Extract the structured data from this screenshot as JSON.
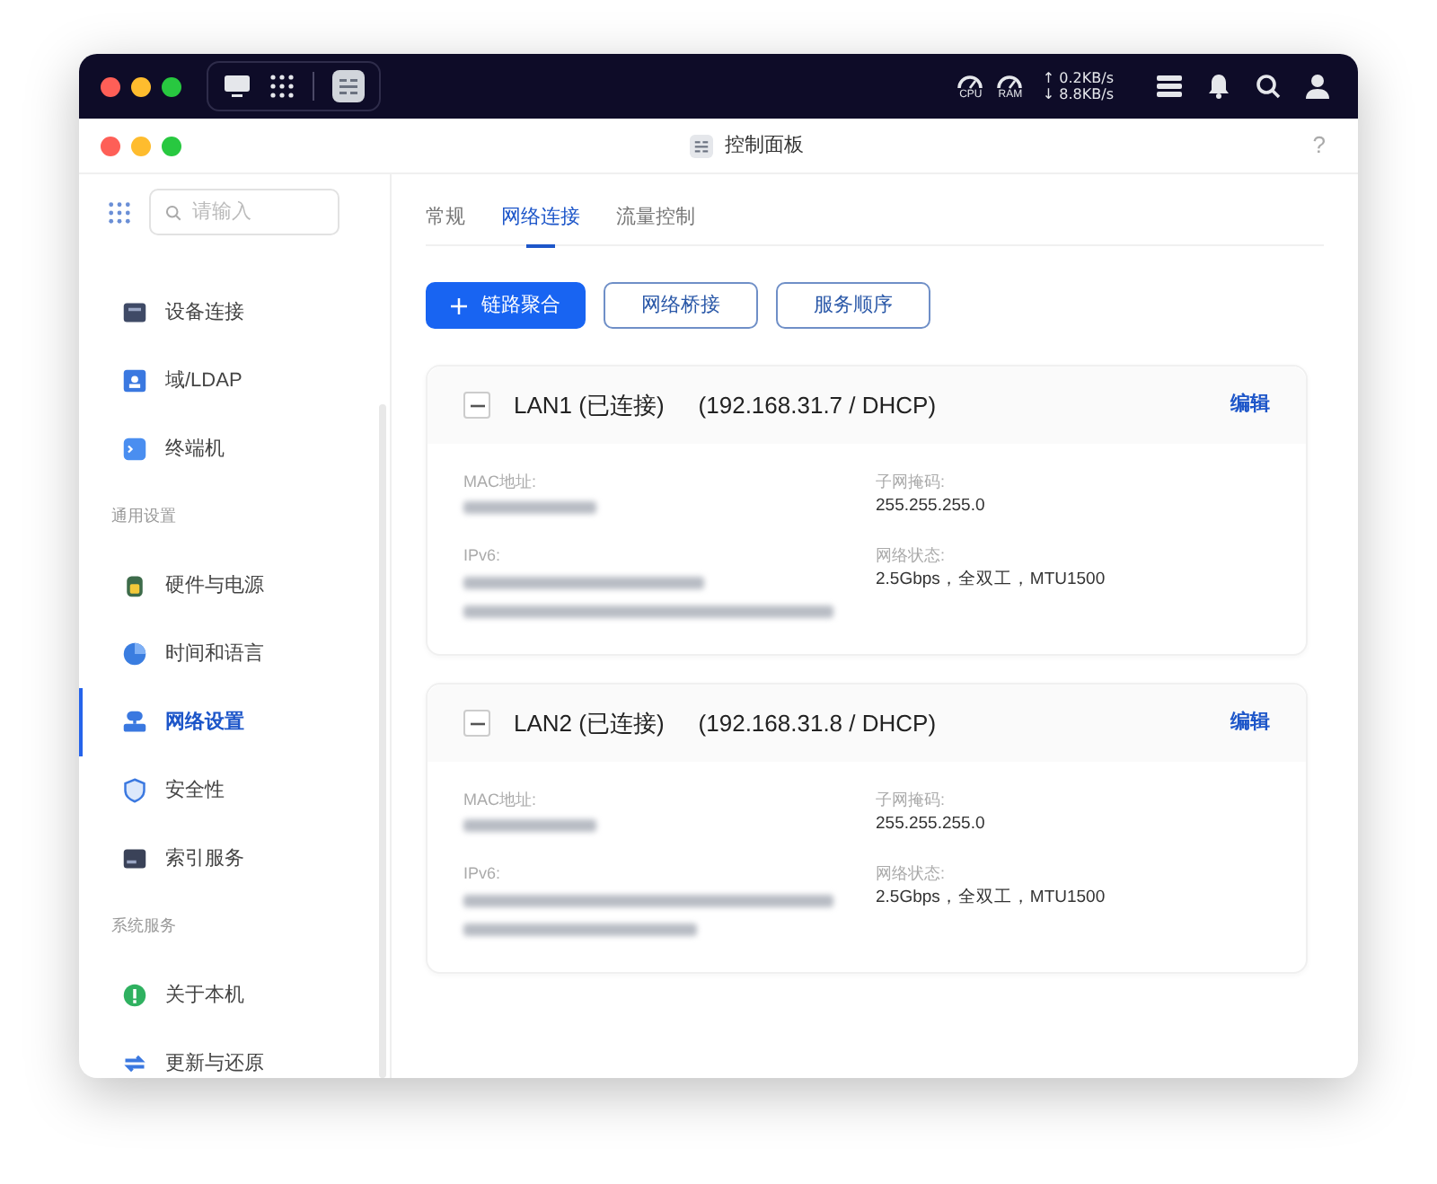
{
  "top_bar": {
    "gauges": [
      {
        "label": "CPU"
      },
      {
        "label": "RAM"
      }
    ],
    "upload": "↑ 0.2KB/s",
    "download": "↓ 8.8KB/s"
  },
  "window": {
    "title": "控制面板",
    "help": "?"
  },
  "search": {
    "placeholder": "请输入"
  },
  "sidebar": {
    "items": [
      {
        "kind": "item",
        "label": "设备连接",
        "selected": false
      },
      {
        "kind": "item",
        "label": "域/LDAP",
        "selected": false
      },
      {
        "kind": "item",
        "label": "终端机",
        "selected": false
      },
      {
        "kind": "section",
        "label": "通用设置"
      },
      {
        "kind": "item",
        "label": "硬件与电源",
        "selected": false
      },
      {
        "kind": "item",
        "label": "时间和语言",
        "selected": false
      },
      {
        "kind": "item",
        "label": "网络设置",
        "selected": true
      },
      {
        "kind": "item",
        "label": "安全性",
        "selected": false
      },
      {
        "kind": "item",
        "label": "索引服务",
        "selected": false
      },
      {
        "kind": "section",
        "label": "系统服务"
      },
      {
        "kind": "item",
        "label": "关于本机",
        "selected": false
      },
      {
        "kind": "item",
        "label": "更新与还原",
        "selected": false
      }
    ]
  },
  "tabs": [
    {
      "label": "常规",
      "selected": false
    },
    {
      "label": "网络连接",
      "selected": true
    },
    {
      "label": "流量控制",
      "selected": false
    }
  ],
  "buttons": [
    {
      "label": "链路聚合",
      "kind": "primary"
    },
    {
      "label": "网络桥接",
      "kind": "outline"
    },
    {
      "label": "服务顺序",
      "kind": "outline"
    }
  ],
  "interfaces": [
    {
      "name": "LAN1 (已连接)",
      "address": "(192.168.31.7 / DHCP)",
      "edit": "编辑",
      "expanded": true,
      "mac_label": "MAC地址:",
      "ipv6_label": "IPv6:",
      "mask_label": "子网掩码:",
      "mask": "255.255.255.0",
      "status_label": "网络状态:",
      "status": "2.5Gbps，全双工，MTU1500"
    },
    {
      "name": "LAN2 (已连接)",
      "address": "(192.168.31.8 / DHCP)",
      "edit": "编辑",
      "expanded": true,
      "mac_label": "MAC地址:",
      "ipv6_label": "IPv6:",
      "mask_label": "子网掩码:",
      "mask": "255.255.255.0",
      "status_label": "网络状态:",
      "status": "2.5Gbps，全双工，MTU1500"
    }
  ]
}
